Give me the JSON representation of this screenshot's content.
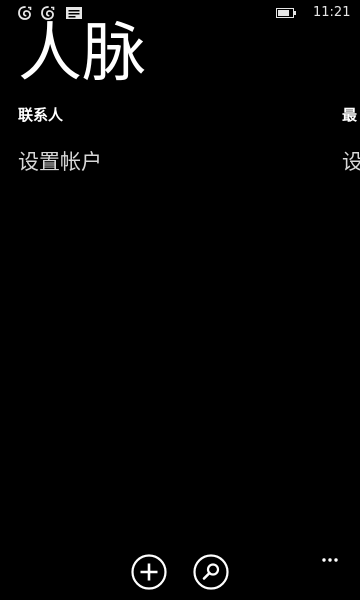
{
  "status_bar": {
    "notifications": [
      "messaging-icon",
      "messaging-icon",
      "text-message-icon"
    ],
    "battery_icon": "battery-icon",
    "time": "11:21"
  },
  "app": {
    "title": "人脉"
  },
  "pivot": {
    "contacts": {
      "header": "联系人",
      "item": "设置帐户"
    },
    "recent": {
      "header": "最",
      "item": "设"
    }
  },
  "app_bar": {
    "buttons": [
      {
        "icon": "add-icon"
      },
      {
        "icon": "search-icon"
      }
    ],
    "more_icon": "more-icon"
  },
  "colors": {
    "background": "#000000",
    "foreground": "#ffffff"
  }
}
